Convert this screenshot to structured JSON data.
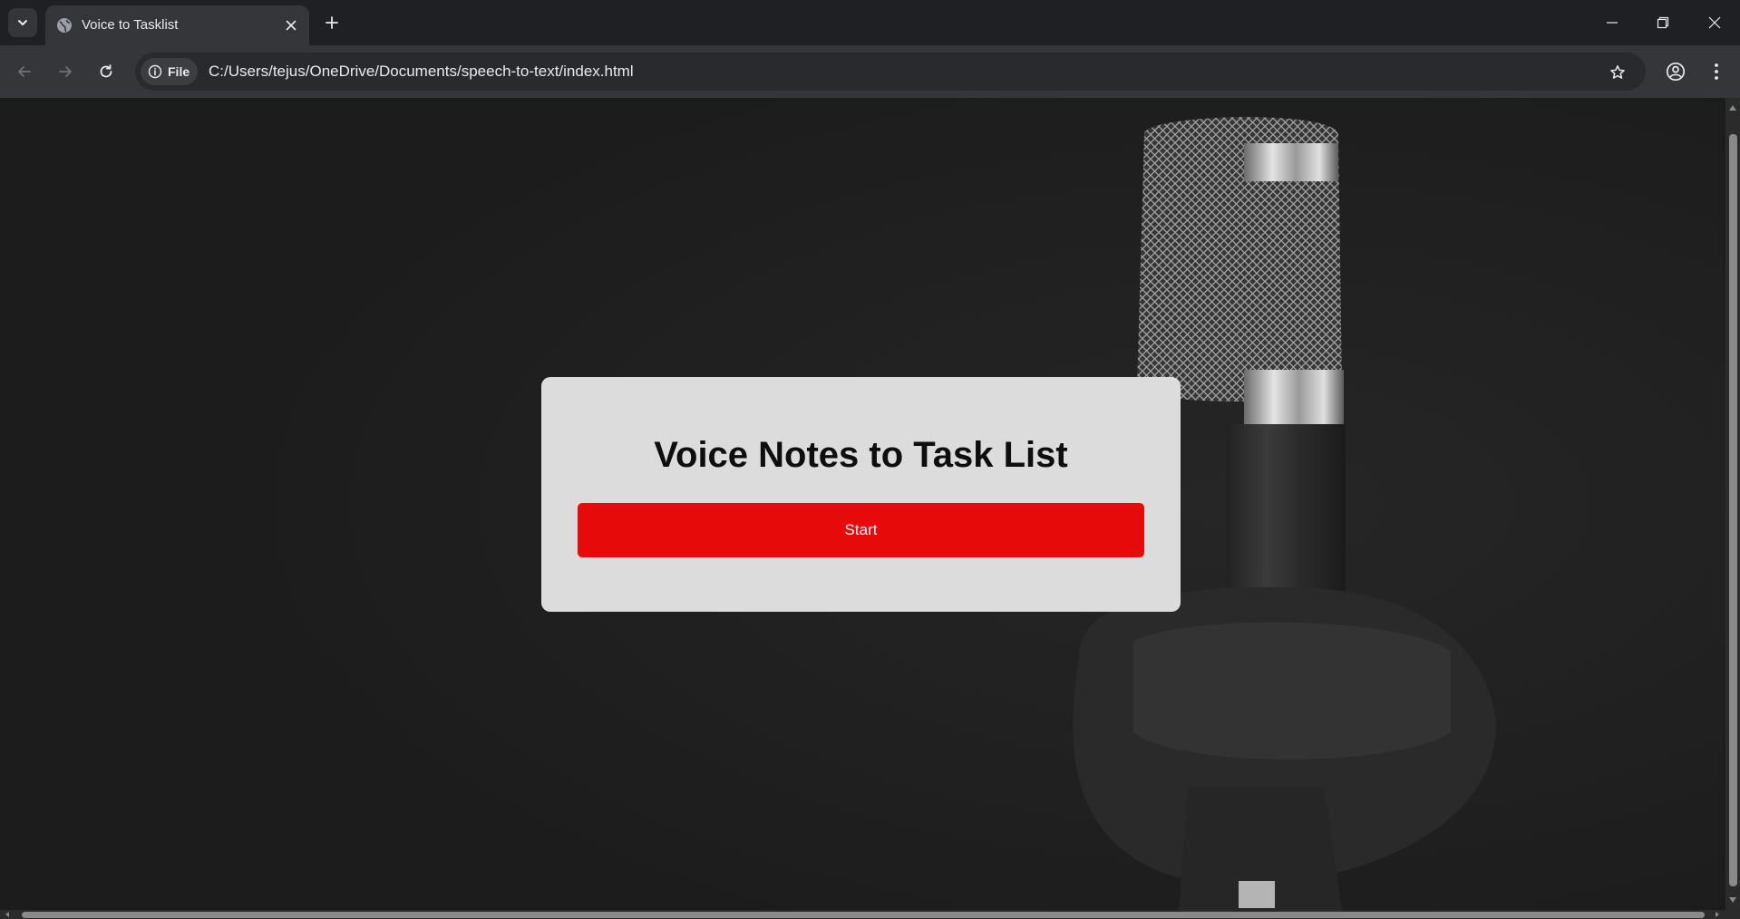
{
  "browser": {
    "tab": {
      "title": "Voice to Tasklist"
    },
    "omnibox": {
      "chip_label": "File",
      "url": "C:/Users/tejus/OneDrive/Documents/speech-to-text/index.html"
    },
    "icons": {
      "tab_search": "chevron-down-icon",
      "favicon": "globe-icon",
      "tab_close": "close-icon",
      "new_tab": "plus-icon",
      "minimize": "minimize-icon",
      "restore": "restore-icon",
      "close_window": "close-icon",
      "back": "arrow-left-icon",
      "forward": "arrow-right-icon",
      "reload": "reload-icon",
      "info": "info-icon",
      "bookmark": "star-icon",
      "profile": "account-circle-icon",
      "menu": "kebab-menu-icon"
    }
  },
  "page": {
    "title": "Voice Notes to Task List",
    "start_button": "Start",
    "background": "microphone-photo",
    "colors": {
      "card": "#dcdcdc",
      "button": "#e60a0a",
      "button_text": "#ffffff",
      "page_bg": "#1e1e1e"
    }
  }
}
